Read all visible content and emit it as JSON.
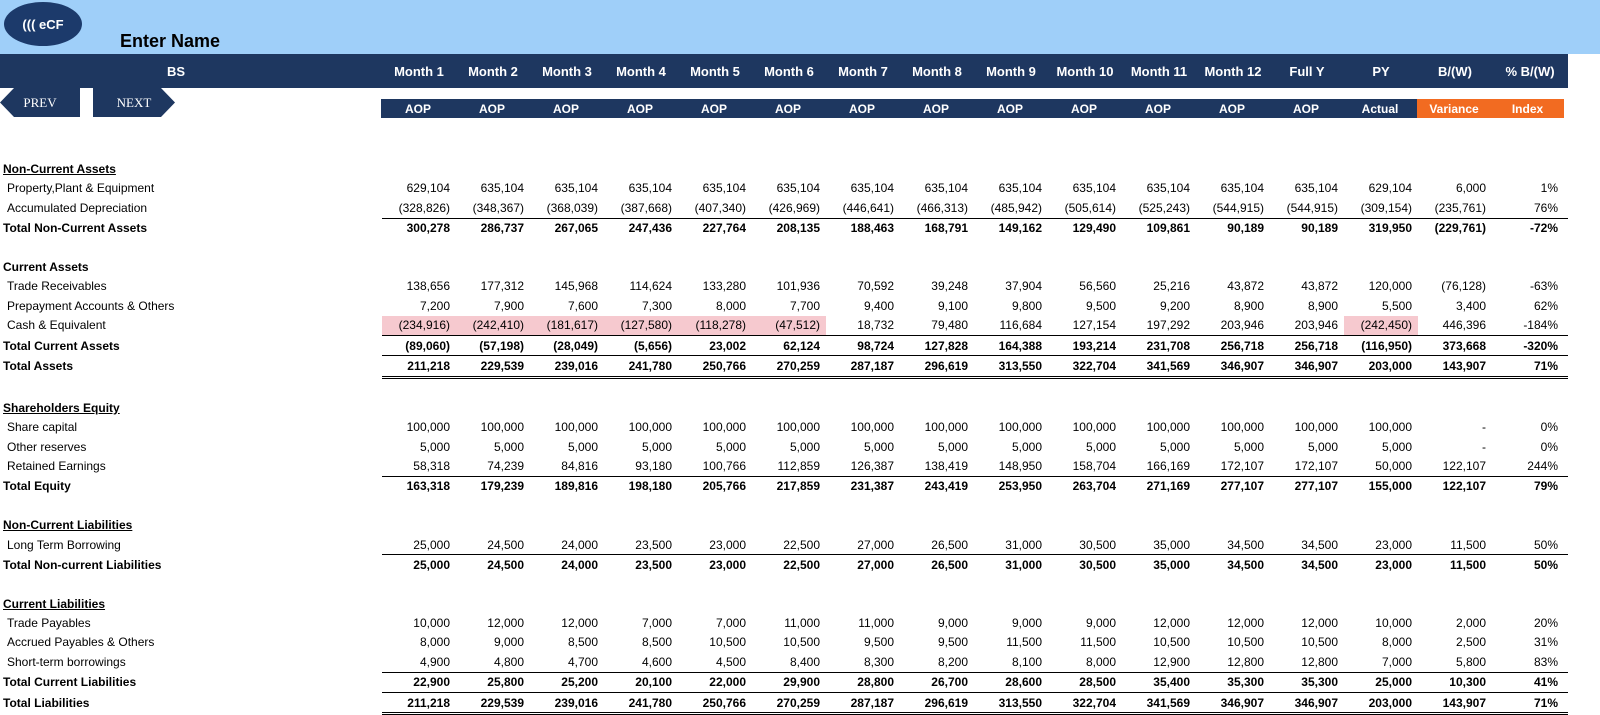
{
  "app": {
    "logo": "((( eCF",
    "title": "Enter Name"
  },
  "nav": {
    "prev": "PREV",
    "next": "NEXT"
  },
  "header": {
    "sheet": "BS",
    "columns": [
      "Month 1",
      "Month 2",
      "Month 3",
      "Month 4",
      "Month 5",
      "Month 6",
      "Month 7",
      "Month 8",
      "Month 9",
      "Month 10",
      "Month 11",
      "Month 12",
      "Full Y",
      "PY",
      "B/(W)",
      "% B/(W)"
    ],
    "subheaders": [
      "AOP",
      "AOP",
      "AOP",
      "AOP",
      "AOP",
      "AOP",
      "AOP",
      "AOP",
      "AOP",
      "AOP",
      "AOP",
      "AOP",
      "AOP",
      "Actual",
      "Variance",
      "Index"
    ]
  },
  "colors": {
    "header_bg": "#1e3760",
    "top_bg": "#9fcff9",
    "accent_orange": "#f26b21",
    "negative_highlight": "#f6c9cf"
  },
  "rows": [
    {
      "type": "blank"
    },
    {
      "type": "section",
      "label": "Non-Current Assets"
    },
    {
      "type": "item",
      "label": "Property,Plant & Equipment",
      "values": [
        "629,104",
        "635,104",
        "635,104",
        "635,104",
        "635,104",
        "635,104",
        "635,104",
        "635,104",
        "635,104",
        "635,104",
        "635,104",
        "635,104",
        "635,104",
        "629,104",
        "6,000",
        "1%"
      ]
    },
    {
      "type": "item",
      "label": "Accumulated Depreciation",
      "values": [
        "(328,826)",
        "(348,367)",
        "(368,039)",
        "(387,668)",
        "(407,340)",
        "(426,969)",
        "(446,641)",
        "(466,313)",
        "(485,942)",
        "(505,614)",
        "(525,243)",
        "(544,915)",
        "(544,915)",
        "(309,154)",
        "(235,761)",
        "76%"
      ]
    },
    {
      "type": "total",
      "label": "Total Non-Current Assets",
      "values": [
        "300,278",
        "286,737",
        "267,065",
        "247,436",
        "227,764",
        "208,135",
        "188,463",
        "168,791",
        "149,162",
        "129,490",
        "109,861",
        "90,189",
        "90,189",
        "319,950",
        "(229,761)",
        "-72%"
      ]
    },
    {
      "type": "blank"
    },
    {
      "type": "sectionplain",
      "label": "Current Assets"
    },
    {
      "type": "item",
      "label": "Trade Receivables",
      "values": [
        "138,656",
        "177,312",
        "145,968",
        "114,624",
        "133,280",
        "101,936",
        "70,592",
        "39,248",
        "37,904",
        "56,560",
        "25,216",
        "43,872",
        "43,872",
        "120,000",
        "(76,128)",
        "-63%"
      ]
    },
    {
      "type": "item",
      "label": "Prepayment Accounts & Others",
      "values": [
        "7,200",
        "7,900",
        "7,600",
        "7,300",
        "8,000",
        "7,700",
        "9,400",
        "9,100",
        "9,800",
        "9,500",
        "9,200",
        "8,900",
        "8,900",
        "5,500",
        "3,400",
        "62%"
      ]
    },
    {
      "type": "item",
      "label": "Cash  & Equivalent",
      "values": [
        "(234,916)",
        "(242,410)",
        "(181,617)",
        "(127,580)",
        "(118,278)",
        "(47,512)",
        "18,732",
        "79,480",
        "116,684",
        "127,154",
        "197,292",
        "203,946",
        "203,946",
        "(242,450)",
        "446,396",
        "-184%"
      ]
    },
    {
      "type": "total",
      "label": "Total Current Assets",
      "values": [
        "(89,060)",
        "(57,198)",
        "(28,049)",
        "(5,656)",
        "23,002",
        "62,124",
        "98,724",
        "127,828",
        "164,388",
        "193,214",
        "231,708",
        "256,718",
        "256,718",
        "(116,950)",
        "373,668",
        "-320%"
      ]
    },
    {
      "type": "grand",
      "label": "Total Assets",
      "values": [
        "211,218",
        "229,539",
        "239,016",
        "241,780",
        "250,766",
        "270,259",
        "287,187",
        "296,619",
        "313,550",
        "322,704",
        "341,569",
        "346,907",
        "346,907",
        "203,000",
        "143,907",
        "71%"
      ]
    },
    {
      "type": "blank"
    },
    {
      "type": "section",
      "label": "Shareholders Equity"
    },
    {
      "type": "item",
      "label": "Share capital",
      "values": [
        "100,000",
        "100,000",
        "100,000",
        "100,000",
        "100,000",
        "100,000",
        "100,000",
        "100,000",
        "100,000",
        "100,000",
        "100,000",
        "100,000",
        "100,000",
        "100,000",
        "-",
        "0%"
      ]
    },
    {
      "type": "item",
      "label": "Other reserves",
      "values": [
        "5,000",
        "5,000",
        "5,000",
        "5,000",
        "5,000",
        "5,000",
        "5,000",
        "5,000",
        "5,000",
        "5,000",
        "5,000",
        "5,000",
        "5,000",
        "5,000",
        "-",
        "0%"
      ]
    },
    {
      "type": "item",
      "label": "Retained Earnings",
      "values": [
        "58,318",
        "74,239",
        "84,816",
        "93,180",
        "100,766",
        "112,859",
        "126,387",
        "138,419",
        "148,950",
        "158,704",
        "166,169",
        "172,107",
        "172,107",
        "50,000",
        "122,107",
        "244%"
      ]
    },
    {
      "type": "total",
      "label": "Total Equity",
      "values": [
        "163,318",
        "179,239",
        "189,816",
        "198,180",
        "205,766",
        "217,859",
        "231,387",
        "243,419",
        "253,950",
        "263,704",
        "271,169",
        "277,107",
        "277,107",
        "155,000",
        "122,107",
        "79%"
      ]
    },
    {
      "type": "blank"
    },
    {
      "type": "section",
      "label": "Non-Current Liabilities"
    },
    {
      "type": "item",
      "label": "Long Term Borrowing",
      "values": [
        "25,000",
        "24,500",
        "24,000",
        "23,500",
        "23,000",
        "22,500",
        "27,000",
        "26,500",
        "31,000",
        "30,500",
        "35,000",
        "34,500",
        "34,500",
        "23,000",
        "11,500",
        "50%"
      ]
    },
    {
      "type": "total",
      "label": "Total Non-current Liabilities",
      "values": [
        "25,000",
        "24,500",
        "24,000",
        "23,500",
        "23,000",
        "22,500",
        "27,000",
        "26,500",
        "31,000",
        "30,500",
        "35,000",
        "34,500",
        "34,500",
        "23,000",
        "11,500",
        "50%"
      ]
    },
    {
      "type": "blank"
    },
    {
      "type": "section",
      "label": "Current Liabilities"
    },
    {
      "type": "item",
      "label": "Trade Payables",
      "values": [
        "10,000",
        "12,000",
        "12,000",
        "7,000",
        "7,000",
        "11,000",
        "11,000",
        "9,000",
        "9,000",
        "9,000",
        "12,000",
        "12,000",
        "12,000",
        "10,000",
        "2,000",
        "20%"
      ]
    },
    {
      "type": "item",
      "label": "Accrued Payables & Others",
      "values": [
        "8,000",
        "9,000",
        "8,500",
        "8,500",
        "10,500",
        "10,500",
        "9,500",
        "9,500",
        "11,500",
        "11,500",
        "10,500",
        "10,500",
        "10,500",
        "8,000",
        "2,500",
        "31%"
      ]
    },
    {
      "type": "item",
      "label": "Short-term borrowings",
      "values": [
        "4,900",
        "4,800",
        "4,700",
        "4,600",
        "4,500",
        "8,400",
        "8,300",
        "8,200",
        "8,100",
        "8,000",
        "12,900",
        "12,800",
        "12,800",
        "7,000",
        "5,800",
        "83%"
      ]
    },
    {
      "type": "total",
      "label": "Total Current Liabilities",
      "values": [
        "22,900",
        "25,800",
        "25,200",
        "20,100",
        "22,000",
        "29,900",
        "28,800",
        "26,700",
        "28,600",
        "28,500",
        "35,400",
        "35,300",
        "35,300",
        "25,000",
        "10,300",
        "41%"
      ]
    },
    {
      "type": "grand",
      "label": "Total Liabilities",
      "values": [
        "211,218",
        "229,539",
        "239,016",
        "241,780",
        "250,766",
        "270,259",
        "287,187",
        "296,619",
        "313,550",
        "322,704",
        "341,569",
        "346,907",
        "346,907",
        "203,000",
        "143,907",
        "71%"
      ]
    }
  ]
}
